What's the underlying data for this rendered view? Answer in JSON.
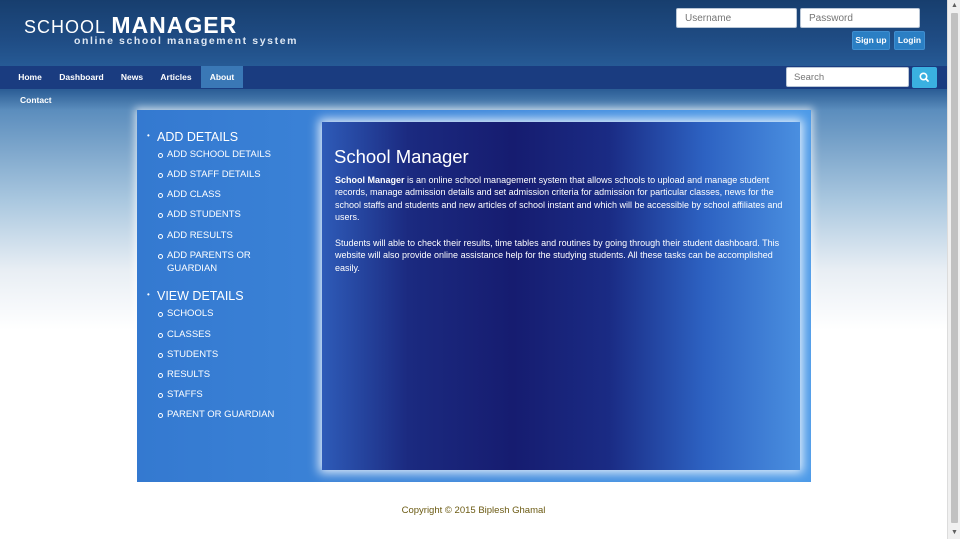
{
  "header": {
    "logo_small": "SCHOOL ",
    "logo_big": "MANAGER",
    "tagline": "online school management system",
    "username_placeholder": "Username",
    "password_placeholder": "Password",
    "signup_label": "Sign up",
    "login_label": "Login"
  },
  "nav": {
    "items": [
      {
        "label": "Home"
      },
      {
        "label": "Dashboard"
      },
      {
        "label": "News"
      },
      {
        "label": "Articles"
      },
      {
        "label": "About"
      }
    ],
    "contact": "Contact",
    "search_placeholder": "Search"
  },
  "sidebar": {
    "add_heading": "ADD DETAILS",
    "add_items": [
      "ADD SCHOOL DETAILS",
      "ADD STAFF DETAILS",
      "ADD CLASS",
      "ADD STUDENTS",
      "ADD RESULTS",
      "ADD PARENTS OR GUARDIAN"
    ],
    "view_heading": "VIEW DETAILS",
    "view_items": [
      "SCHOOLS",
      "CLASSES",
      "STUDENTS",
      "RESULTS",
      "STAFFS",
      "PARENT OR GUARDIAN"
    ]
  },
  "content": {
    "title": "School Manager",
    "p1_bold": "School Manager",
    "p1_text": " is an online school management system that allows schools to upload and manage student records, manage admission details and set admission criteria for admission for particular classes, news for the school staffs and students and new articles of school instant and which will be accessible by school affiliates and users.",
    "p2_text": "Students will able to check their results, time tables and routines by going through their student dashboard. This website will also provide online assistance help for the studying students. All these tasks can be accomplished easily."
  },
  "footer": {
    "copyright": "Copyright © 2015 Biplesh Ghamal"
  },
  "colors": {
    "header_bg": "#1f4c84",
    "nav_bg": "#1a3c80",
    "nav_active": "#3a78b6",
    "panel_bg": "#4c9ae8",
    "content_bg": "#161c70",
    "search_button": "#3ab0e0",
    "footer_text": "#6b5a12"
  },
  "icons": {
    "search_button": "magnifier-icon",
    "scroll_up": "triangle-up-icon",
    "scroll_down": "triangle-down-icon"
  }
}
